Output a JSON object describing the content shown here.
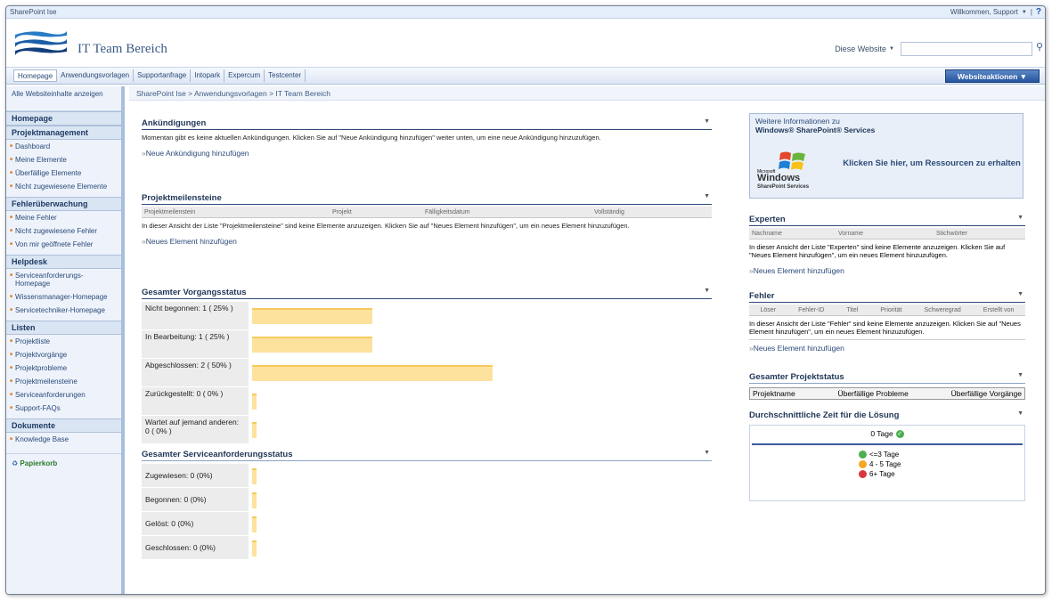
{
  "topbar": {
    "site_root": "SharePoint Ise",
    "welcome": "Willkommen, Support",
    "welcome_arrow": "▼",
    "sep": "|"
  },
  "header": {
    "title": "IT Team Bereich",
    "search_scope": "Diese Website",
    "search_placeholder": ""
  },
  "nav": {
    "tabs": [
      "Homepage",
      "Anwendungsvorlagen",
      "Supportanfrage",
      "Intopark",
      "Expercum",
      "Testcenter"
    ],
    "site_actions": "Websiteaktionen ▼"
  },
  "sidebar": {
    "all_content": "Alle Websiteinhalte anzeigen",
    "sections": [
      {
        "title": "Homepage",
        "items": []
      },
      {
        "title": "Projektmanagement",
        "items": [
          "Dashboard",
          "Meine Elemente",
          "Überfällige Elemente",
          "Nicht zugewiesene Elemente"
        ]
      },
      {
        "title": "Fehlerüberwachung",
        "items": [
          "Meine Fehler",
          "Nicht zugewiesene Fehler",
          "Von mir geöffnete Fehler"
        ]
      },
      {
        "title": "Helpdesk",
        "items": [
          "Serviceanforderungs-Homepage",
          "Wissensmanager-Homepage",
          "Servicetechniker-Homepage"
        ]
      },
      {
        "title": "Listen",
        "items": [
          "Projektliste",
          "Projektvorgänge",
          "Projektprobleme",
          "Projektmeilensteine",
          "Serviceanforderungen",
          "Support-FAQs"
        ]
      },
      {
        "title": "Dokumente",
        "items": [
          "Knowledge Base"
        ]
      }
    ],
    "recycle": "Papierkorb"
  },
  "breadcrumb": "SharePoint Ise > Anwendungsvorlagen > IT Team Bereich",
  "announcements": {
    "title": "Ankündigungen",
    "text": "Momentan gibt es keine aktuellen Ankündigungen. Klicken Sie auf \"Neue Ankündigung hinzufügen\" weiter unten, um eine neue Ankündigung hinzuzufügen.",
    "add": "Neue Ankündigung hinzufügen"
  },
  "milestones": {
    "title": "Projektmeilensteine",
    "columns": [
      "Projektmeilenstein",
      "Projekt",
      "Fälligkeitsdatum",
      "Vollständig"
    ],
    "text": "In dieser Ansicht der Liste \"Projektmeilensteine\" sind keine Elemente anzuzeigen. Klicken Sie auf \"Neues Element hinzufügen\", um ein neues Element hinzuzufügen.",
    "add": "Neues Element hinzufügen"
  },
  "issue_status": {
    "title": "Gesamter Vorgangsstatus",
    "rows": [
      {
        "label": "Nicht begonnen: 1 ( 25% )",
        "pct": 25
      },
      {
        "label": "In Bearbeitung: 1 ( 25% )",
        "pct": 25
      },
      {
        "label": "Abgeschlossen: 2 ( 50% )",
        "pct": 50
      },
      {
        "label": "Zurückgestellt: 0 ( 0% )",
        "pct": 0
      },
      {
        "label": "Wartet auf jemand anderen: 0 ( 0% )",
        "pct": 0
      }
    ]
  },
  "service_status": {
    "title": "Gesamter Serviceanforderungsstatus",
    "rows": [
      {
        "label": "Zugewiesen: 0 (0%)",
        "pct": 0
      },
      {
        "label": "Begonnen: 0 (0%)",
        "pct": 0
      },
      {
        "label": "Gelöst: 0 (0%)",
        "pct": 0
      },
      {
        "label": "Geschlossen: 0 (0%)",
        "pct": 0
      }
    ]
  },
  "info": {
    "line1": "Weitere Informationen zu",
    "line2": "Windows® SharePoint® Services",
    "click": "Klicken Sie hier, um Ressourcen zu erhalten",
    "logo_small": "Microsoft",
    "logo_big": "Windows",
    "logo_sub": "SharePoint Services"
  },
  "experts": {
    "title": "Experten",
    "columns": [
      "Nachname",
      "Vorname",
      "Stichwörter"
    ],
    "text": "In dieser Ansicht der Liste \"Experten\" sind keine Elemente anzuzeigen. Klicken Sie auf \"Neues Element hinzufügen\", um ein neues Element hinzuzufügen.",
    "add": "Neues Element hinzufügen"
  },
  "bugs": {
    "title": "Fehler",
    "columns": [
      "Löser",
      "Fehler-ID",
      "Titel",
      "Priorität",
      "Schweregrad",
      "Erstellt von"
    ],
    "text": "In dieser Ansicht der Liste \"Fehler\" sind keine Elemente anzuzeigen. Klicken Sie auf \"Neues Element hinzufügen\", um ein neues Element hinzuzufügen.",
    "add": "Neues Element hinzufügen"
  },
  "project_status": {
    "title": "Gesamter Projektstatus",
    "columns": [
      "Projektname",
      "Überfällige Probleme",
      "Überfällige Vorgänge"
    ]
  },
  "resolution": {
    "title": "Durchschnittliche Zeit für die Lösung",
    "value": "0 Tage",
    "legend": [
      {
        "label": "<=3 Tage",
        "color": "#4caf50"
      },
      {
        "label": "4 - 5 Tage",
        "color": "#f5a623"
      },
      {
        "label": "6+ Tage",
        "color": "#d9363e"
      }
    ]
  },
  "menu_glyph": "▼"
}
